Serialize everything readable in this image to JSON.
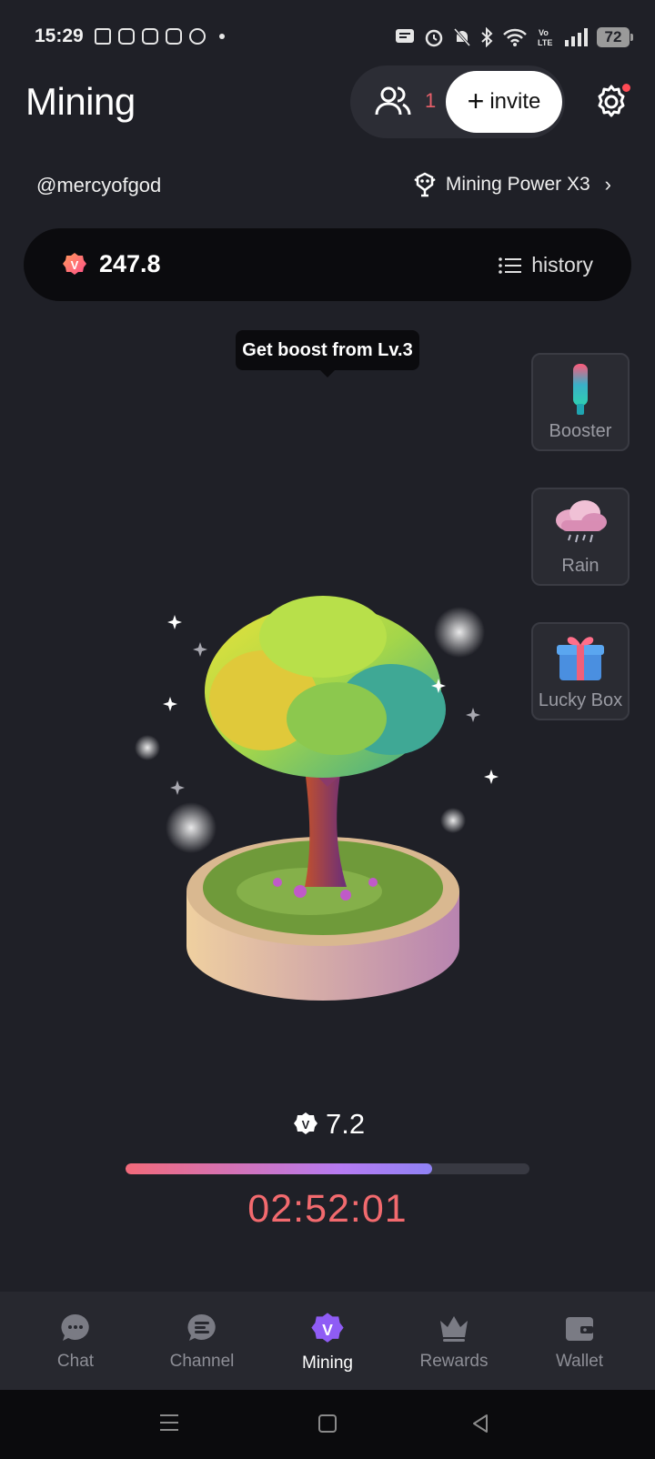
{
  "status_bar": {
    "time": "15:29",
    "battery": "72",
    "icons": [
      "facebook-icon",
      "instagram-icon",
      "instagram-icon",
      "instagram-icon",
      "whatsapp-icon",
      "dot",
      "message-icon",
      "alarm-icon",
      "muted-bell-icon",
      "bluetooth-icon",
      "wifi-icon",
      "volte-icon",
      "signal-icon",
      "battery-icon"
    ]
  },
  "header": {
    "title": "Mining",
    "friends_count": "1",
    "invite_label": "invite"
  },
  "user": {
    "username": "@mercyofgod",
    "mining_power": "Mining Power X3"
  },
  "balance": {
    "value": "247.8",
    "history_label": "history"
  },
  "tooltip": "Get boost from Lv.3",
  "side_items": [
    {
      "label": "Booster"
    },
    {
      "label": "Rain"
    },
    {
      "label": "Lucky Box"
    }
  ],
  "mining": {
    "reward": "7.2",
    "progress": 0.76,
    "timer": "02:52:01"
  },
  "nav": [
    {
      "label": "Chat"
    },
    {
      "label": "Channel"
    },
    {
      "label": "Mining"
    },
    {
      "label": "Rewards"
    },
    {
      "label": "Wallet"
    }
  ],
  "colors": {
    "background": "#1f2027",
    "accent_red": "#f26a6e",
    "accent_purple": "#8f5cf5",
    "progress_start": "#f26a7a",
    "progress_end": "#8f82f5"
  }
}
